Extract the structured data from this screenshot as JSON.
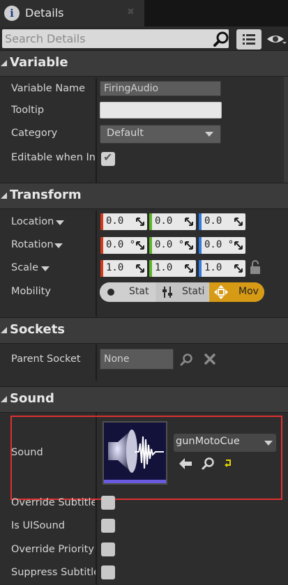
{
  "tab": {
    "title": "Details",
    "icon_glyph": "i"
  },
  "search": {
    "placeholder": "Search Details"
  },
  "sections": {
    "variable": {
      "title": "Variable",
      "variable_name_label": "Variable Name",
      "variable_name_value": "FiringAudio",
      "tooltip_label": "Tooltip",
      "tooltip_value": "",
      "category_label": "Category",
      "category_value": "Default",
      "editable_label": "Editable when Inh",
      "editable_checked": true
    },
    "transform": {
      "title": "Transform",
      "location_label": "Location",
      "rotation_label": "Rotation",
      "scale_label": "Scale",
      "mobility_label": "Mobility",
      "location": [
        "0.0",
        "0.0",
        "0.0"
      ],
      "rotation": [
        "0.0 °",
        "0.0 °",
        "0.0 °"
      ],
      "scale": [
        "1.0",
        "1.0",
        "1.0"
      ],
      "mobility_options": [
        "Stat",
        "Stati",
        "Mov"
      ],
      "mobility_selected": "Mov"
    },
    "sockets": {
      "title": "Sockets",
      "parent_socket_label": "Parent Socket",
      "parent_socket_value": "None"
    },
    "sound": {
      "title": "Sound",
      "sound_label": "Sound",
      "sound_asset": "gunMotoCue",
      "override_subtitle_label": "Override Subtitle",
      "is_uisound_label": "Is UISound",
      "override_priority_label": "Override Priority",
      "suppress_subtitle_label": "Suppress Subtitle"
    }
  },
  "colors": {
    "x_axis": "#d23a1e",
    "y_axis": "#5fb52a",
    "z_axis": "#2f7be0",
    "mobility_selected": "#d69a14",
    "highlight": "#e03030"
  }
}
